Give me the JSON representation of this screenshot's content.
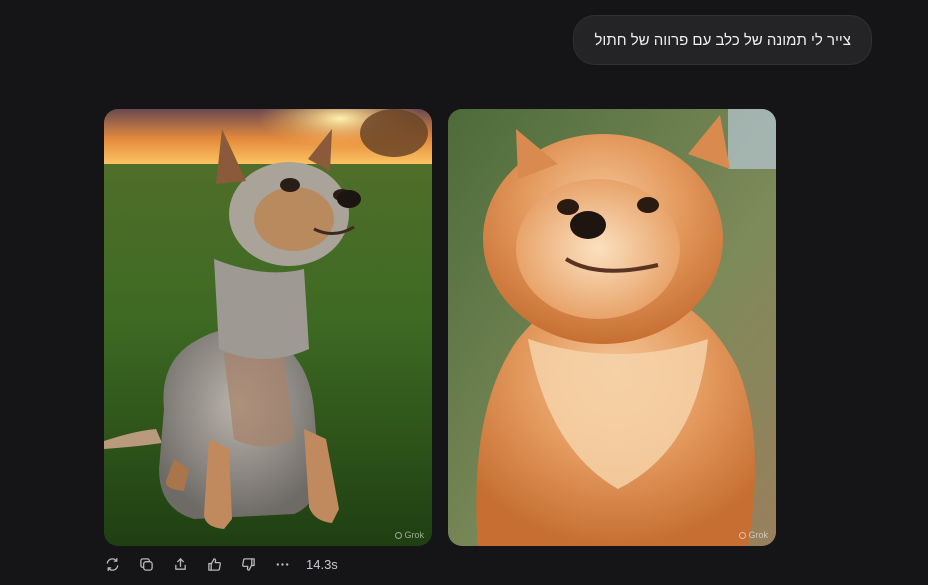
{
  "conversation": {
    "user_message": "צייר לי תמונה של כלב עם פרווה של חתול"
  },
  "images": [
    {
      "alt": "Small grey and tan terrier dog sitting on grass at sunset",
      "watermark": "Grok"
    },
    {
      "alt": "Fluffy orange Pomeranian-like dog in golden light",
      "watermark": "Grok"
    }
  ],
  "actions": {
    "icons": [
      "regenerate-icon",
      "copy-icon",
      "share-icon",
      "thumbs-up-icon",
      "thumbs-down-icon",
      "more-icon"
    ],
    "response_time": "14.3s"
  },
  "colors": {
    "background": "#151517",
    "bubble": "#242427"
  }
}
